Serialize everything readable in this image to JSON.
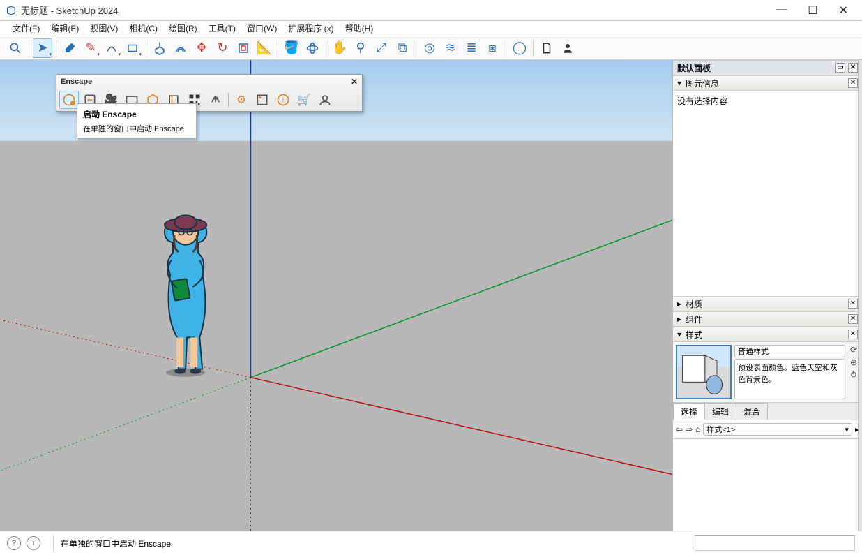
{
  "window": {
    "title": "无标题 - SketchUp 2024"
  },
  "menu": [
    "文件(F)",
    "编辑(E)",
    "视图(V)",
    "相机(C)",
    "绘图(R)",
    "工具(T)",
    "窗口(W)",
    "扩展程序 (x)",
    "帮助(H)"
  ],
  "enscape": {
    "title": "Enscape",
    "tooltip_title": "启动 Enscape",
    "tooltip_body": "在单独的窗口中启动 Enscape"
  },
  "panel": {
    "main": "默认面板",
    "entity": {
      "title": "图元信息",
      "body": "没有选择内容"
    },
    "material": "材质",
    "component": "组件",
    "style": {
      "title": "样式",
      "name": "普通样式",
      "desc": "预设表面颜色。蓝色天空和灰色背景色。",
      "tabs": [
        "选择",
        "编辑",
        "混合"
      ],
      "selector": "样式<1>"
    }
  },
  "status": {
    "text": "在单独的窗口中启动 Enscape"
  }
}
